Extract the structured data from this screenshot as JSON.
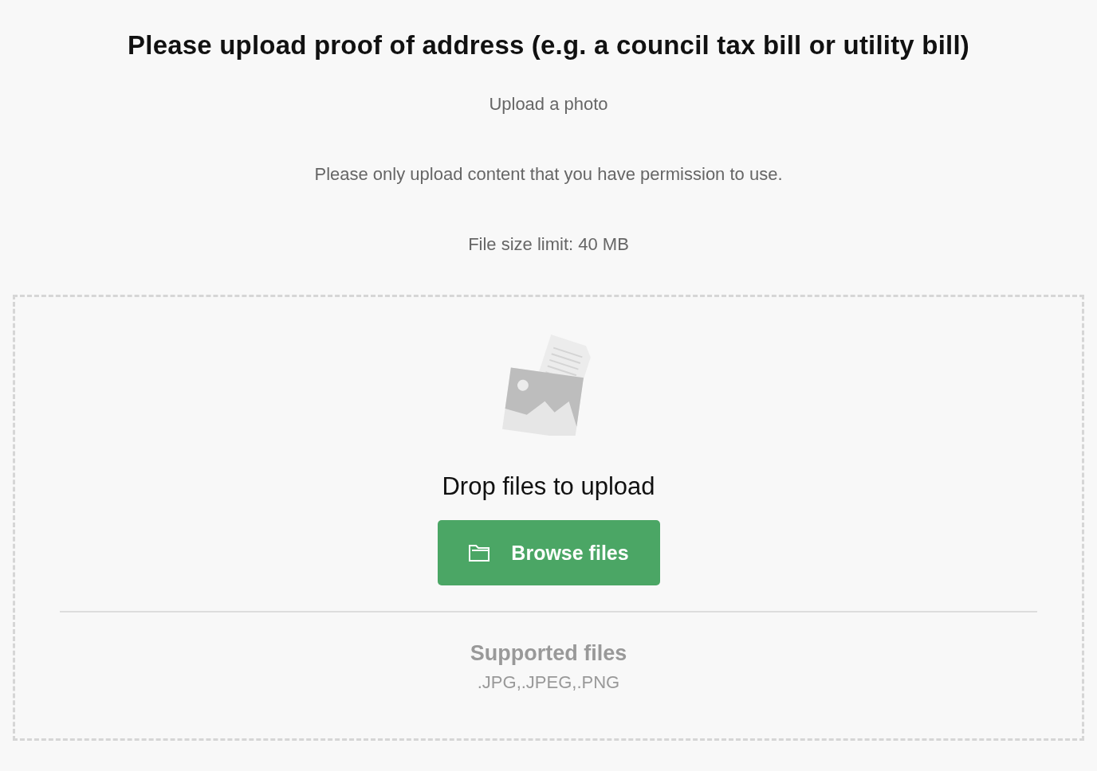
{
  "heading": "Please upload proof of address (e.g. a council tax bill or utility bill)",
  "subtitle": "Upload a photo",
  "notes": [
    "Please only upload content that you have permission to use.",
    "File size limit: 40 MB"
  ],
  "dropzone": {
    "prompt": "Drop files to upload",
    "button": "Browse files",
    "supported_title": "Supported files",
    "supported_types": ".JPG,.JPEG,.PNG"
  }
}
